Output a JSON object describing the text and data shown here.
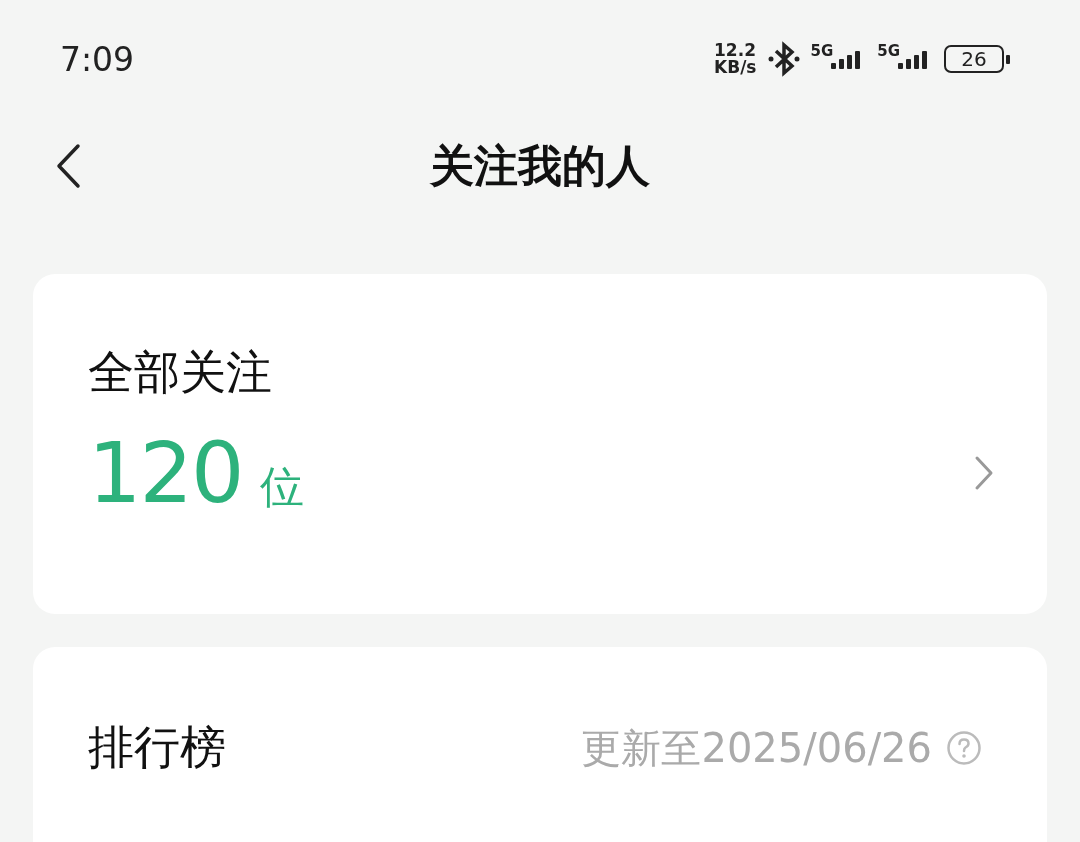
{
  "status_bar": {
    "time": "7:09",
    "speed_value": "12.2",
    "speed_unit": "KB/s",
    "sim_labels": [
      "5G",
      "5G"
    ],
    "battery": "26"
  },
  "header": {
    "title": "关注我的人"
  },
  "followers_card": {
    "title": "全部关注",
    "count": "120",
    "unit": "位"
  },
  "ranking_card": {
    "title": "排行榜",
    "updated": "更新至2025/06/26"
  }
}
